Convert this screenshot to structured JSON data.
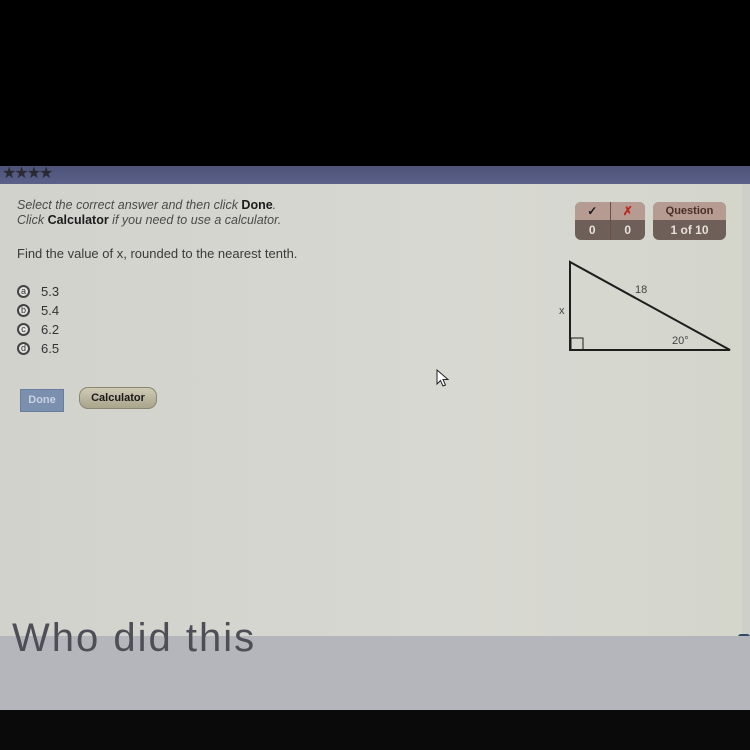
{
  "header": {
    "stars": "★★★★"
  },
  "instructions": {
    "line1_prefix": "Select the correct answer and then click ",
    "line1_bold": "Done",
    "line1_suffix": ".",
    "line2_prefix": "Click ",
    "line2_bold": "Calculator",
    "line2_suffix": " if you need to use a calculator."
  },
  "score": {
    "correct_icon": "✓",
    "incorrect_icon": "✗",
    "correct_count": "0",
    "incorrect_count": "0",
    "correct_color": "#1a1a1a",
    "incorrect_color": "#c0281e"
  },
  "question_counter": {
    "label": "Question",
    "value": "1 of 10"
  },
  "question": {
    "text": "Find the value of x, rounded to the nearest tenth."
  },
  "choices": [
    {
      "letter": "a",
      "value": "5.3"
    },
    {
      "letter": "b",
      "value": "5.4"
    },
    {
      "letter": "c",
      "value": "6.2"
    },
    {
      "letter": "d",
      "value": "6.5"
    }
  ],
  "figure": {
    "hypotenuse_label": "18",
    "side_label": "x",
    "angle_label": "20°"
  },
  "buttons": {
    "done": "Done",
    "calculator": "Calculator"
  },
  "bottom": {
    "clipped_text": "Who did this"
  }
}
